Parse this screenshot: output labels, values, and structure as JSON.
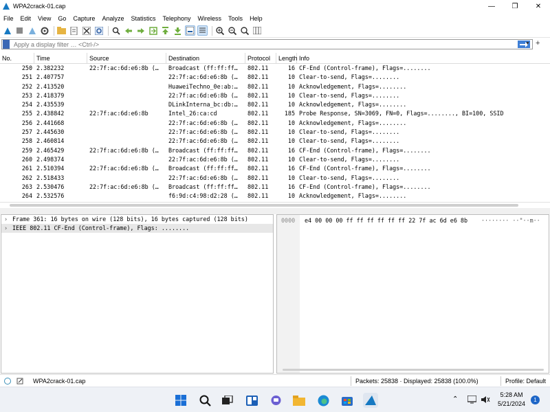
{
  "window": {
    "title": "WPA2crack-01.cap",
    "minimize": "—",
    "maximize": "❐",
    "close": "✕"
  },
  "menu": [
    "File",
    "Edit",
    "View",
    "Go",
    "Capture",
    "Analyze",
    "Statistics",
    "Telephony",
    "Wireless",
    "Tools",
    "Help"
  ],
  "filter": {
    "placeholder": "Apply a display filter … <Ctrl-/>"
  },
  "columns": {
    "no": "No.",
    "time": "Time",
    "source": "Source",
    "destination": "Destination",
    "protocol": "Protocol",
    "length": "Length",
    "info": "Info"
  },
  "packets": [
    {
      "no": "250",
      "time": "2.382232",
      "src": "22:7f:ac:6d:e6:8b (…",
      "dst": "Broadcast (ff:ff:ff…",
      "proto": "802.11",
      "len": "16",
      "info": "CF-End (Control-frame), Flags=........"
    },
    {
      "no": "251",
      "time": "2.407757",
      "src": "",
      "dst": "22:7f:ac:6d:e6:8b (…",
      "proto": "802.11",
      "len": "10",
      "info": "Clear-to-send, Flags=........"
    },
    {
      "no": "252",
      "time": "2.413520",
      "src": "",
      "dst": "HuaweiTechno_0e:ab:…",
      "proto": "802.11",
      "len": "10",
      "info": "Acknowledgement, Flags=........"
    },
    {
      "no": "253",
      "time": "2.418379",
      "src": "",
      "dst": "22:7f:ac:6d:e6:8b (…",
      "proto": "802.11",
      "len": "10",
      "info": "Clear-to-send, Flags=........"
    },
    {
      "no": "254",
      "time": "2.435539",
      "src": "",
      "dst": "DLinkInterna_bc:db:…",
      "proto": "802.11",
      "len": "10",
      "info": "Acknowledgement, Flags=........"
    },
    {
      "no": "255",
      "time": "2.438842",
      "src": "22:7f:ac:6d:e6:8b",
      "dst": "Intel_26:ca:cd",
      "proto": "802.11",
      "len": "185",
      "info": "Probe Response, SN=3069, FN=0, Flags=........, BI=100, SSID"
    },
    {
      "no": "256",
      "time": "2.441668",
      "src": "",
      "dst": "22:7f:ac:6d:e6:8b (…",
      "proto": "802.11",
      "len": "10",
      "info": "Acknowledgement, Flags=........"
    },
    {
      "no": "257",
      "time": "2.445630",
      "src": "",
      "dst": "22:7f:ac:6d:e6:8b (…",
      "proto": "802.11",
      "len": "10",
      "info": "Clear-to-send, Flags=........"
    },
    {
      "no": "258",
      "time": "2.460814",
      "src": "",
      "dst": "22:7f:ac:6d:e6:8b (…",
      "proto": "802.11",
      "len": "10",
      "info": "Clear-to-send, Flags=........"
    },
    {
      "no": "259",
      "time": "2.465429",
      "src": "22:7f:ac:6d:e6:8b (…",
      "dst": "Broadcast (ff:ff:ff…",
      "proto": "802.11",
      "len": "16",
      "info": "CF-End (Control-frame), Flags=........"
    },
    {
      "no": "260",
      "time": "2.498374",
      "src": "",
      "dst": "22:7f:ac:6d:e6:8b (…",
      "proto": "802.11",
      "len": "10",
      "info": "Clear-to-send, Flags=........"
    },
    {
      "no": "261",
      "time": "2.510394",
      "src": "22:7f:ac:6d:e6:8b (…",
      "dst": "Broadcast (ff:ff:ff…",
      "proto": "802.11",
      "len": "16",
      "info": "CF-End (Control-frame), Flags=........"
    },
    {
      "no": "262",
      "time": "2.518433",
      "src": "",
      "dst": "22:7f:ac:6d:e6:8b (…",
      "proto": "802.11",
      "len": "10",
      "info": "Clear-to-send, Flags=........"
    },
    {
      "no": "263",
      "time": "2.530476",
      "src": "22:7f:ac:6d:e6:8b (…",
      "dst": "Broadcast (ff:ff:ff…",
      "proto": "802.11",
      "len": "16",
      "info": "CF-End (Control-frame), Flags=........"
    },
    {
      "no": "264",
      "time": "2.532576",
      "src": "",
      "dst": "f6:9d:c4:98:d2:28 (…",
      "proto": "802.11",
      "len": "10",
      "info": "Acknowledgement, Flags=........"
    }
  ],
  "details": [
    {
      "arrow": "›",
      "text": "Frame 361: 16 bytes on wire (128 bits), 16 bytes captured (128 bits)"
    },
    {
      "arrow": "›",
      "text": "IEEE 802.11 CF-End (Control-frame), Flags: ........"
    }
  ],
  "bytes": {
    "offset": "0000",
    "hex": "e4 00 00 00 ff ff ff ff  ff ff 22 7f ac 6d e6 8b",
    "ascii": "········ ··\"··m··"
  },
  "status": {
    "file": "WPA2crack-01.cap",
    "packets": "Packets: 25838 · Displayed: 25838 (100.0%)",
    "profile": "Profile: Default"
  },
  "clock": {
    "time": "5:28 AM",
    "date": "5/21/2024",
    "notifications": "1"
  },
  "colors": {
    "accent": "#3f7fd6",
    "wireshark_fin": "#1679c2"
  }
}
